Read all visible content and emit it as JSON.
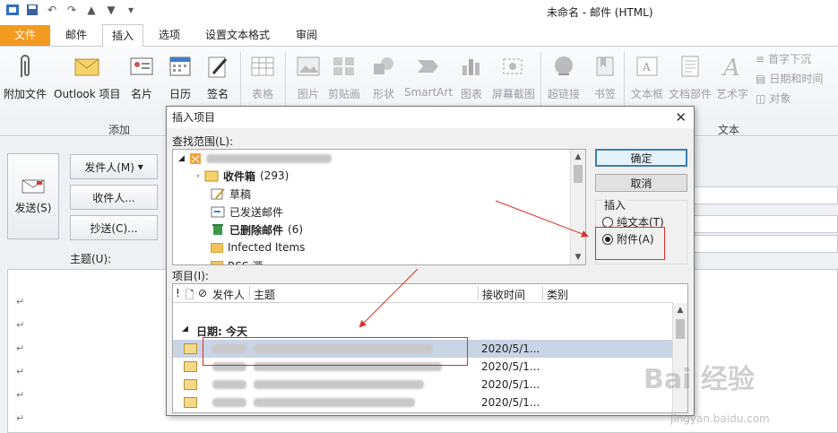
{
  "window": {
    "title": "未命名 - 邮件 (HTML)"
  },
  "tabs": [
    {
      "label": "文件"
    },
    {
      "label": "邮件"
    },
    {
      "label": "插入"
    },
    {
      "label": "选项"
    },
    {
      "label": "设置文本格式"
    },
    {
      "label": "审阅"
    }
  ],
  "ribbon": {
    "include": {
      "attach_file": "附加文件",
      "outlook_item": "Outlook 项目",
      "business_card": "名片",
      "calendar": "日历",
      "signature": "签名",
      "group_label": "添加"
    },
    "tables": {
      "table": "表格"
    },
    "illustrations": {
      "picture": "图片",
      "clipart": "剪贴画",
      "shapes": "形状",
      "smartart": "SmartArt",
      "chart": "图表",
      "screenshot": "屏幕截图"
    },
    "links": {
      "hyperlink": "超链接",
      "bookmark": "书签"
    },
    "text": {
      "textbox": "文本框",
      "quickparts": "文档部件",
      "wordart": "艺术字",
      "dropcap": "首字下沉",
      "datetime": "日期和时间",
      "object": "对象",
      "group_label": "文本"
    }
  },
  "compose": {
    "send": "发送(S)",
    "from": "发件人(M)",
    "to": "收件人...",
    "cc": "抄送(C)...",
    "subject_label": "主题(U):"
  },
  "dialog": {
    "title": "插入项目",
    "look_in_label": "查找范围(L):",
    "tree": [
      {
        "label": "收件箱",
        "count": "(293)",
        "bold": true
      },
      {
        "label": "草稿"
      },
      {
        "label": "已发送邮件"
      },
      {
        "label": "已删除邮件",
        "count": "(6)",
        "bold": true
      },
      {
        "label": "Infected Items"
      },
      {
        "label": "RSS 源"
      }
    ],
    "ok": "确定",
    "cancel": "取消",
    "insert_as_label": "插入",
    "insert_options": [
      {
        "label": "纯文本(T)",
        "selected": false
      },
      {
        "label": "附件(A)",
        "selected": true
      }
    ],
    "items_label": "项目(I):",
    "columns": [
      "!",
      "发件人",
      "主题",
      "接收时间",
      "类别"
    ],
    "group_header": "日期: 今天",
    "rows": [
      {
        "date": "2020/5/1..."
      },
      {
        "date": "2020/5/1..."
      },
      {
        "date": "2020/5/1..."
      },
      {
        "date": "2020/5/1..."
      }
    ]
  },
  "watermark": {
    "brand": "Bai 经验",
    "url": "jingyan.baidu.com"
  }
}
